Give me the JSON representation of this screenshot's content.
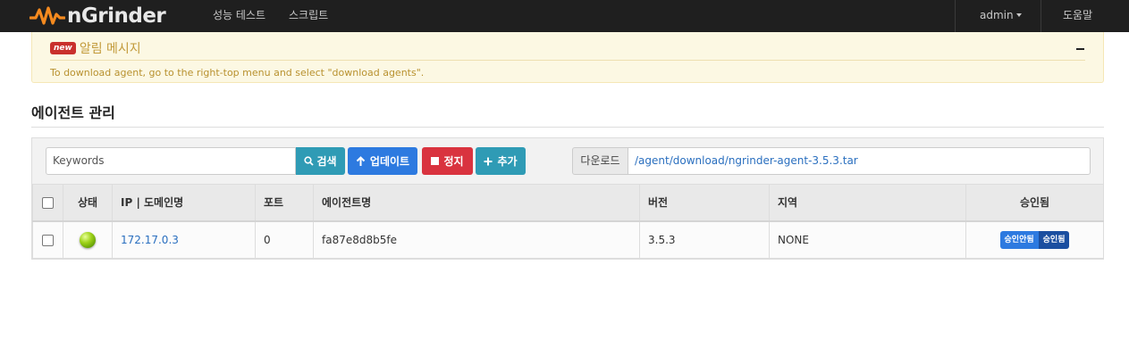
{
  "navbar": {
    "brand": "nGrinder",
    "menu": [
      "성능 테스트",
      "스크립트"
    ],
    "user": "admin",
    "help": "도움말"
  },
  "alert": {
    "badge": "new",
    "title": "알림 메시지",
    "message": "To download agent, go to the right-top menu and select \"download agents\"."
  },
  "page": {
    "title": "에이전트 관리"
  },
  "toolbar": {
    "search_placeholder": "Keywords",
    "search_label": "검색",
    "update_label": "업데이트",
    "stop_label": "정지",
    "add_label": "추가",
    "download_label": "다운로드",
    "download_link": "/agent/download/ngrinder-agent-3.5.3.tar"
  },
  "table": {
    "headers": [
      "상태",
      "IP | 도메인명",
      "포트",
      "에이전트명",
      "버전",
      "지역",
      "승인됨"
    ],
    "rows": [
      {
        "status": "running",
        "ip": "172.17.0.3",
        "port": "0",
        "name": "fa87e8d8b5fe",
        "version": "3.5.3",
        "region": "NONE",
        "disapprove_label": "승인안됨",
        "approve_label": "승인됨"
      }
    ]
  },
  "colors": {
    "navbar": "#1f1f1f",
    "brand_accent": "#f58a1f",
    "search_button": "#2f9bb5",
    "update_button": "#2d7ae0",
    "stop_button": "#d9333f",
    "add_button": "#2f9bb5",
    "status_ok": "#9ed21a"
  }
}
